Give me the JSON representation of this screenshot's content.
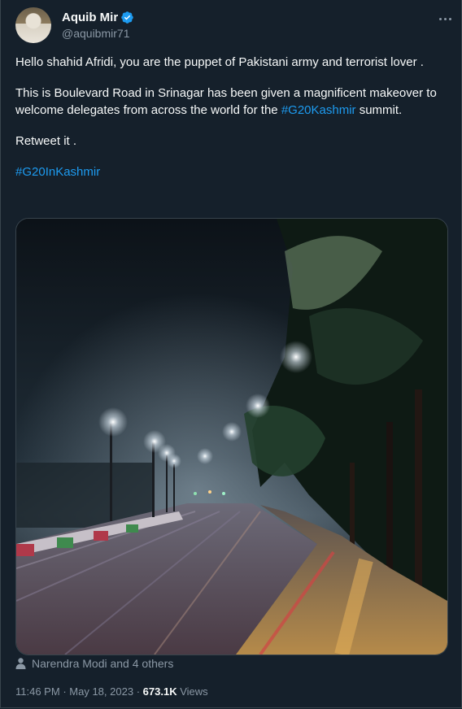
{
  "author": {
    "name": "Aquib Mir",
    "handle": "@aquibmir71"
  },
  "tweet": {
    "line1": "Hello shahid Afridi, you are the puppet of Pakistani army and terrorist lover .",
    "line2_pre": "This is Boulevard Road in Srinagar has been given a magnificent makeover to welcome delegates from across the world for the ",
    "line2_hashtag": "#G20Kashmir",
    "line2_post": " summit.",
    "line3": "Retweet it .",
    "line4_hashtag": "#G20InKashmir"
  },
  "liked_by": "Narendra Modi and 4 others",
  "meta": {
    "time": "11:46 PM",
    "separator": "·",
    "date": "May 18, 2023",
    "views_count": "673.1K",
    "views_label": "Views"
  },
  "icons": {
    "verified": "verified-badge-icon",
    "more": "more-options-icon",
    "liked": "person-icon"
  },
  "colors": {
    "background": "#15202b",
    "text": "#f7f9f9",
    "secondary": "#8b98a5",
    "accent": "#1d9bf0"
  }
}
